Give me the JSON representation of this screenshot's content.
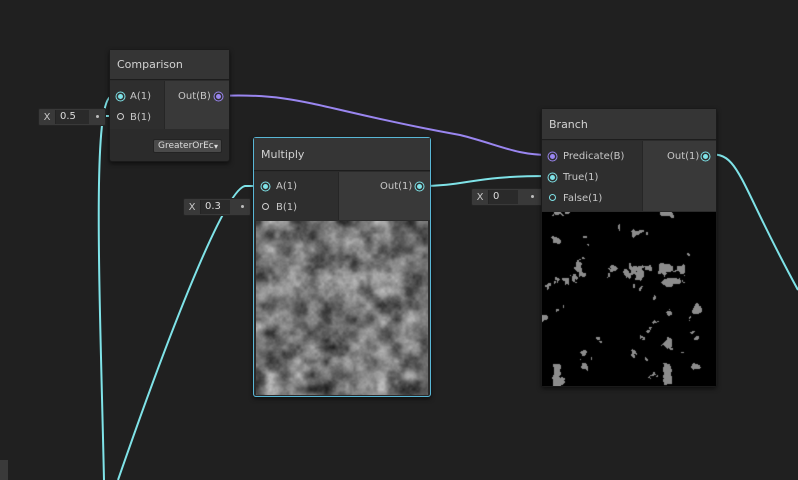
{
  "colors": {
    "background": "#202020",
    "wire_float": "#7fe3e8",
    "wire_bool": "#9a86f0",
    "selection": "#59b7d6"
  },
  "comparison": {
    "title": "Comparison",
    "inputs": [
      "A(1)",
      "B(1)"
    ],
    "output": "Out(B)",
    "mode": "GreaterOrEc",
    "b_field": {
      "axis": "X",
      "value": "0.5"
    }
  },
  "multiply": {
    "title": "Multiply",
    "inputs": [
      "A(1)",
      "B(1)"
    ],
    "output": "Out(1)",
    "b_field": {
      "axis": "X",
      "value": "0.3"
    }
  },
  "branch": {
    "title": "Branch",
    "inputs": [
      "Predicate(B)",
      "True(1)",
      "False(1)"
    ],
    "output": "Out(1)",
    "false_field": {
      "axis": "X",
      "value": "0"
    }
  }
}
